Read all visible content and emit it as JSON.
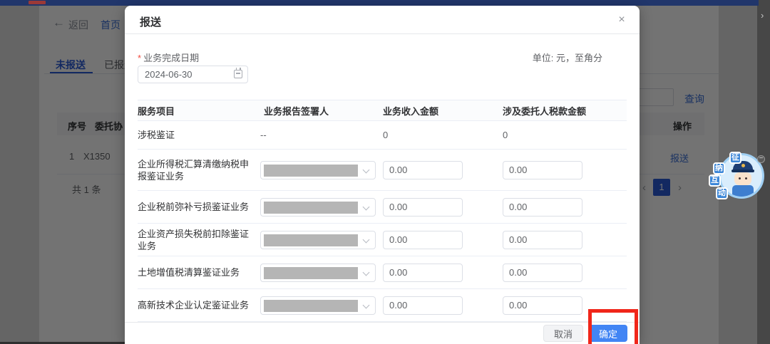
{
  "colors": {
    "topbar_navy": "#21366b",
    "accent_blue": "#3a6fd8",
    "confirm_blue": "#4285f4",
    "annotation_red": "#f0261a",
    "redacted_gray": "#b5b5b5"
  },
  "page": {
    "breadcrumb": {
      "back_arrow": "←",
      "back": "返回",
      "home": "首页"
    },
    "tabs": [
      {
        "label": "未报送"
      },
      {
        "label": "已报送"
      }
    ],
    "query_button": "查询",
    "table": {
      "headers": {
        "index": "序号",
        "agreement": "委托协",
        "action": "操作"
      },
      "row": {
        "index": "1",
        "agreement_no": "X1350",
        "action": "报送"
      }
    },
    "total_text": "共 1 条",
    "pagination": {
      "prev": "‹",
      "current": "1",
      "next": "›"
    },
    "edge_chevron": "›"
  },
  "modal": {
    "title": "报送",
    "close": "×",
    "required_mark": "*",
    "date_label": "业务完成日期",
    "date_value": "2024-06-30",
    "unit_note": "单位: 元，至角分",
    "table": {
      "headers": [
        "服务项目",
        "业务报告签署人",
        "业务收入金额",
        "涉及委托人税款金额"
      ],
      "summary_row": {
        "name": "涉税鉴证",
        "signer": "--",
        "income": "0",
        "tax": "0"
      },
      "rows": [
        {
          "name": "企业所得税汇算清缴纳税申报鉴证业务",
          "income": "0.00",
          "tax": "0.00"
        },
        {
          "name": "企业税前弥补亏损鉴证业务",
          "income": "0.00",
          "tax": "0.00"
        },
        {
          "name": "企业资产损失税前扣除鉴证业务",
          "income": "0.00",
          "tax": "0.00"
        },
        {
          "name": "土地增值税清算鉴证业务",
          "income": "0.00",
          "tax": "0.00"
        },
        {
          "name": "高新技术企业认定鉴证业务",
          "income": "0.00",
          "tax": "0.00"
        }
      ]
    },
    "footer": {
      "cancel": "取消",
      "confirm": "确定"
    }
  },
  "mascot": {
    "labels": [
      "征",
      "纳",
      "互",
      "动"
    ],
    "minimize": "−"
  }
}
